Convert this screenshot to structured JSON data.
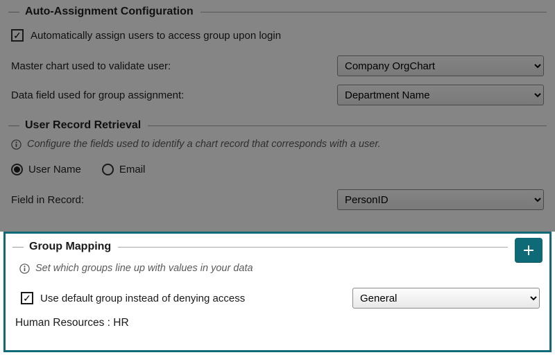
{
  "autoassign": {
    "section_title": "Auto-Assignment Configuration",
    "checkbox_label": "Automatically assign users to access group upon login",
    "checkbox_checked": true,
    "master_chart_label": "Master chart used to validate user:",
    "master_chart_value": "Company OrgChart",
    "data_field_label": "Data field used for group assignment:",
    "data_field_value": "Department Name"
  },
  "retrieval": {
    "section_title": "User Record Retrieval",
    "info_text": "Configure the fields used to identify a chart record that corresponds with a user.",
    "radio_username": "User Name",
    "radio_email": "Email",
    "selected_radio": "username",
    "field_in_record_label": "Field in Record:",
    "field_in_record_value": "PersonID"
  },
  "groupmap": {
    "section_title": "Group Mapping",
    "info_text": "Set which groups line up with values in your data",
    "default_checkbox_label": "Use default group instead of denying access",
    "default_checkbox_checked": true,
    "default_group_value": "General",
    "mapping_display": "Human Resources : HR",
    "add_button_label": "+"
  }
}
